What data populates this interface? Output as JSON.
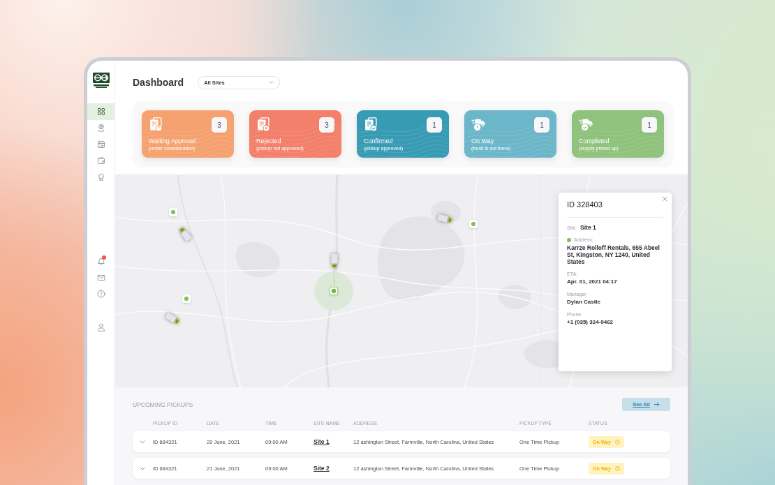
{
  "sidebar": {
    "nav_items": [
      {
        "selected": true
      },
      {
        "selected": false
      },
      {
        "selected": false
      },
      {
        "selected": false
      },
      {
        "selected": false
      }
    ],
    "notifications": {
      "badge": true
    }
  },
  "header": {
    "title": "Dashboard",
    "site_select": {
      "value": "All Sites"
    }
  },
  "cards": [
    {
      "title": "Waiting Approval",
      "subtitle": "(under consideration)",
      "count": "3",
      "color": "#f5a270"
    },
    {
      "title": "Rejected",
      "subtitle": "(pickup not approved)",
      "count": "3",
      "color": "#f2806a"
    },
    {
      "title": "Confirmed",
      "subtitle": "(pickup approved)",
      "count": "1",
      "color": "#389bb4"
    },
    {
      "title": "On Way",
      "subtitle": "(truck is out there)",
      "count": "1",
      "color": "#6cb6ca"
    },
    {
      "title": "Completed",
      "subtitle": "(supply picked up)",
      "count": "1",
      "color": "#8fc27c"
    }
  ],
  "map": {
    "markers": [
      {
        "kind": "pin",
        "selected": false
      },
      {
        "kind": "truck",
        "selected": false
      },
      {
        "kind": "pin",
        "selected": false
      },
      {
        "kind": "truck",
        "selected": false
      },
      {
        "kind": "truck",
        "selected": false
      },
      {
        "kind": "pin",
        "selected": true
      },
      {
        "kind": "pin",
        "selected": false
      },
      {
        "kind": "truck",
        "selected": false
      }
    ],
    "popup": {
      "title": "ID 328403",
      "fields": [
        {
          "kind": "inline",
          "label": "Site:",
          "value": "Site 1"
        },
        {
          "kind": "status",
          "label": "Address:",
          "value": "Karrze Rolloff Rentals, 655 Abeel St, Kingston, NY 1240, United States"
        },
        {
          "kind": "stacked",
          "label": "ETA:",
          "value": "Apr. 01, 2021 04:17"
        },
        {
          "kind": "stacked",
          "label": "Manager",
          "value": "Dylan Castle"
        },
        {
          "kind": "stacked",
          "label": "Phone",
          "value": "+1 (035) 324-9462"
        }
      ]
    }
  },
  "upcoming_pickups": {
    "title": "UPCOMING PICKUPS",
    "see_all": "See All",
    "columns": [
      "PICKUP ID",
      "DATE",
      "TIME",
      "SITE NAME",
      "ADDRESS",
      "PICKUP TYPE",
      "STATUS"
    ],
    "rows": [
      {
        "expanded": false,
        "pickup_id": "ID 684321",
        "date": "20 June, 2021",
        "time": "09:00 AM",
        "site_name": "Site 1",
        "address": "12 ashington Street, Farmville, North Carolina, United States",
        "pickup_type": "One Time Pickup",
        "status": "On Way"
      },
      {
        "expanded": false,
        "pickup_id": "ID 684321",
        "date": "21 June, 2021",
        "time": "09:00 AM",
        "site_name": "Site 2",
        "address": "12 ashington Street, Farmville, North Carolina, United States",
        "pickup_type": "One Time Pickup",
        "status": "On Way"
      }
    ]
  }
}
